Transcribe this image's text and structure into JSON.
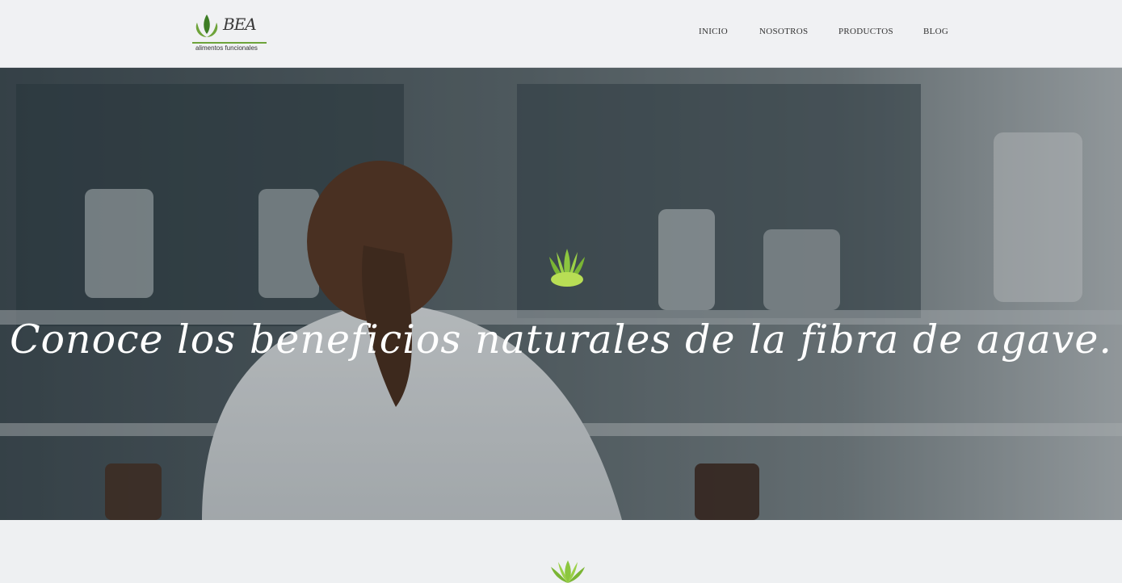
{
  "brand": {
    "name": "BEA",
    "tagline": "alimentos funcionales",
    "accent": "#6ea33a",
    "logo_icon": "leaf-logo-icon"
  },
  "nav": {
    "items": [
      {
        "label": "INICIO"
      },
      {
        "label": "NOSOTROS"
      },
      {
        "label": "PRODUCTOS"
      },
      {
        "label": "BLOG"
      }
    ]
  },
  "hero": {
    "title": "Conoce los beneficios naturales de la fibra de agave.",
    "icon": "agave-icon",
    "background": "laboratory-photo"
  },
  "section": {
    "icon": "agave-icon"
  }
}
